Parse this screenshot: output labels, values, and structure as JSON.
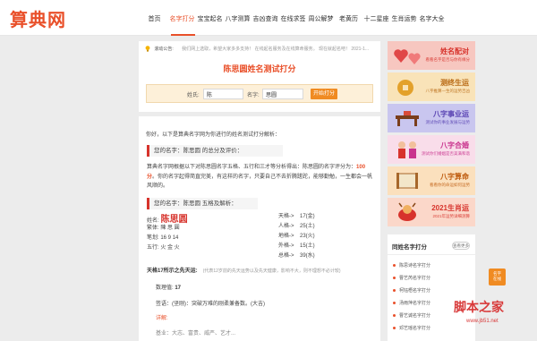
{
  "brand": {
    "logo": "算典网",
    "accent": "#e9502a"
  },
  "nav": {
    "items": [
      "首页",
      "名字打分",
      "宝宝起名",
      "八字测算",
      "吉凶查询",
      "在线求签",
      "周公解梦",
      "老黄历",
      "十二星座",
      "生肖运势",
      "名字大全"
    ],
    "active_index": 1
  },
  "notice": {
    "label": "滚动公告:",
    "text": "我们网上选取，希望大家多多支持！ 在线起名服务及在线算命服务。 现在就起名吧！ 2021-1..."
  },
  "test": {
    "title": "陈思圆姓名测试打分",
    "surname_label": "姓氏:",
    "surname_value": "陈",
    "name_label": "名字:",
    "name_value": "思圆",
    "submit_label": "开始打分"
  },
  "analysis": {
    "intro": "你好，以下是算典名字网为你进行的姓名测试打分解析：",
    "section1_title": "您的名字：陈思圆 的总分及评价：",
    "para_before": "算典名字网根据以下对陈思圆名字五格、五行和三才等分析得出：陈思圆的名字评分为：",
    "score": "100分",
    "para_after": "。你的名字起得简直完美，有这样的名字，只要自己不去折腾蹉跎，能够勤勉，一生都会一帆风顺的。",
    "section2_title": "您的名字：陈思圆 五格及解析：",
    "rows_left": [
      {
        "label": "姓名:",
        "value": "陈思圆"
      },
      {
        "label": "繁体:",
        "value": "陳 思 圓"
      },
      {
        "label": "笔划:",
        "value": "16  9  14"
      },
      {
        "label": "五行:",
        "value": "火  金  火"
      }
    ],
    "rows_right": [
      {
        "label": "天格->",
        "value": "17(金)"
      },
      {
        "label": "人格->",
        "value": "25(土)"
      },
      {
        "label": "地格->",
        "value": "23(火)"
      },
      {
        "label": "外格->",
        "value": "15(土)"
      },
      {
        "label": "总格->",
        "value": "39(水)"
      }
    ],
    "tiange_label": "天格17所示之先天运:",
    "tiange_note": "(代表12岁前的先天运势以及先天健康，影响不大，则不理想不必计较)",
    "shuli_label": "数理值:",
    "shuli_value": "17",
    "jiye_text": "签语：(坚刚)：突破万难的刚柔兼备数。(大吉)",
    "xiangjie": "详解:",
    "cut_text": "基业：大志、富贵、威严、艺才..."
  },
  "sidebar": {
    "banners": [
      {
        "title": "姓名配对",
        "sub": "看看名字是否与你有缘分",
        "bg": "#f7c7c0",
        "color": "#d7332c",
        "icon": "hearts-icon"
      },
      {
        "title": "测终生运",
        "sub": "八字推算一生的运势吉凶",
        "bg": "#f9e3b8",
        "color": "#b96a14",
        "icon": "coin-icon"
      },
      {
        "title": "八字事业运",
        "sub": "测试你的事业发展与运势",
        "bg": "#c9c6ef",
        "color": "#5a44b3",
        "icon": "desk-icon"
      },
      {
        "title": "八字合婚",
        "sub": "测试你们婚姻是否美满和谐",
        "bg": "#f9ddea",
        "color": "#c9338e",
        "icon": "couple-icon"
      },
      {
        "title": "八字算命",
        "sub": "看看你的命运如何运势",
        "bg": "#fbe0bd",
        "color": "#c05e12",
        "icon": "scroll-icon"
      },
      {
        "title": "2021生肖运",
        "sub": "2021年运势详细测算",
        "bg": "#fbd7c9",
        "color": "#d7332c",
        "icon": "ox-icon"
      }
    ],
    "rank_title": "同姓名字打分",
    "rank_more": "查看更多",
    "rank_items": [
      "陈思诗名字打分",
      "曹艺芮名字打分",
      "柯钰梧名字打分",
      "汤雨萍名字打分",
      "曹艺诚名字打分",
      "邓艺瑶名字打分"
    ]
  },
  "float_button": [
    "名字",
    "在线"
  ],
  "watermark": {
    "main": "脚本之家",
    "sub": "www.jb51.net"
  }
}
